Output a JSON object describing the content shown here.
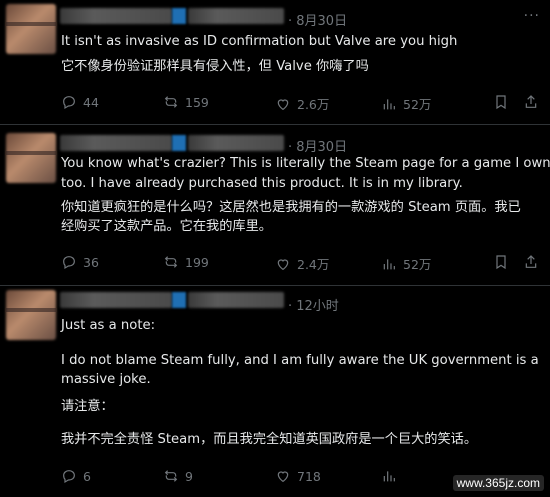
{
  "posts": [
    {
      "time": "· 8月30日",
      "lines": [
        "It isn't as invasive as ID confirmation but Valve are you high",
        "它不像身份验证那样具有侵入性，但 Valve 你嗨了吗"
      ],
      "actions": {
        "replies": "44",
        "reposts": "159",
        "likes": "2.6万",
        "views": "52万"
      }
    },
    {
      "time": "· 8月30日",
      "lines": [
        "You know what's crazier? This is literally the Steam page for a game I own,",
        "too. I have already purchased this product. It is in my library.",
        "你知道更疯狂的是什么吗？这居然也是我拥有的一款游戏的 Steam 页面。我已",
        "经购买了这款产品。它在我的库里。"
      ],
      "actions": {
        "replies": "36",
        "reposts": "199",
        "likes": "2.4万",
        "views": "52万"
      }
    },
    {
      "time": "· 12小时",
      "lines": [
        "Just as a note:",
        "I do not blame Steam fully, and I am fully aware the UK government is a",
        "massive joke.",
        "请注意：",
        "我并不完全责怪 Steam，而且我完全知道英国政府是一个巨大的笑话。"
      ],
      "actions": {
        "replies": "6",
        "reposts": "9",
        "likes": "718",
        "views": ""
      }
    }
  ],
  "icons": {
    "reply": "reply-icon",
    "repost": "repost-icon",
    "like": "like-icon",
    "views": "views-icon",
    "bookmark": "bookmark-icon",
    "share": "share-icon"
  },
  "watermark": "www.365jz.com",
  "colors": {
    "background": "#000000",
    "text": "#e7e9ea",
    "muted": "#71767b",
    "divider": "#2f3336"
  }
}
